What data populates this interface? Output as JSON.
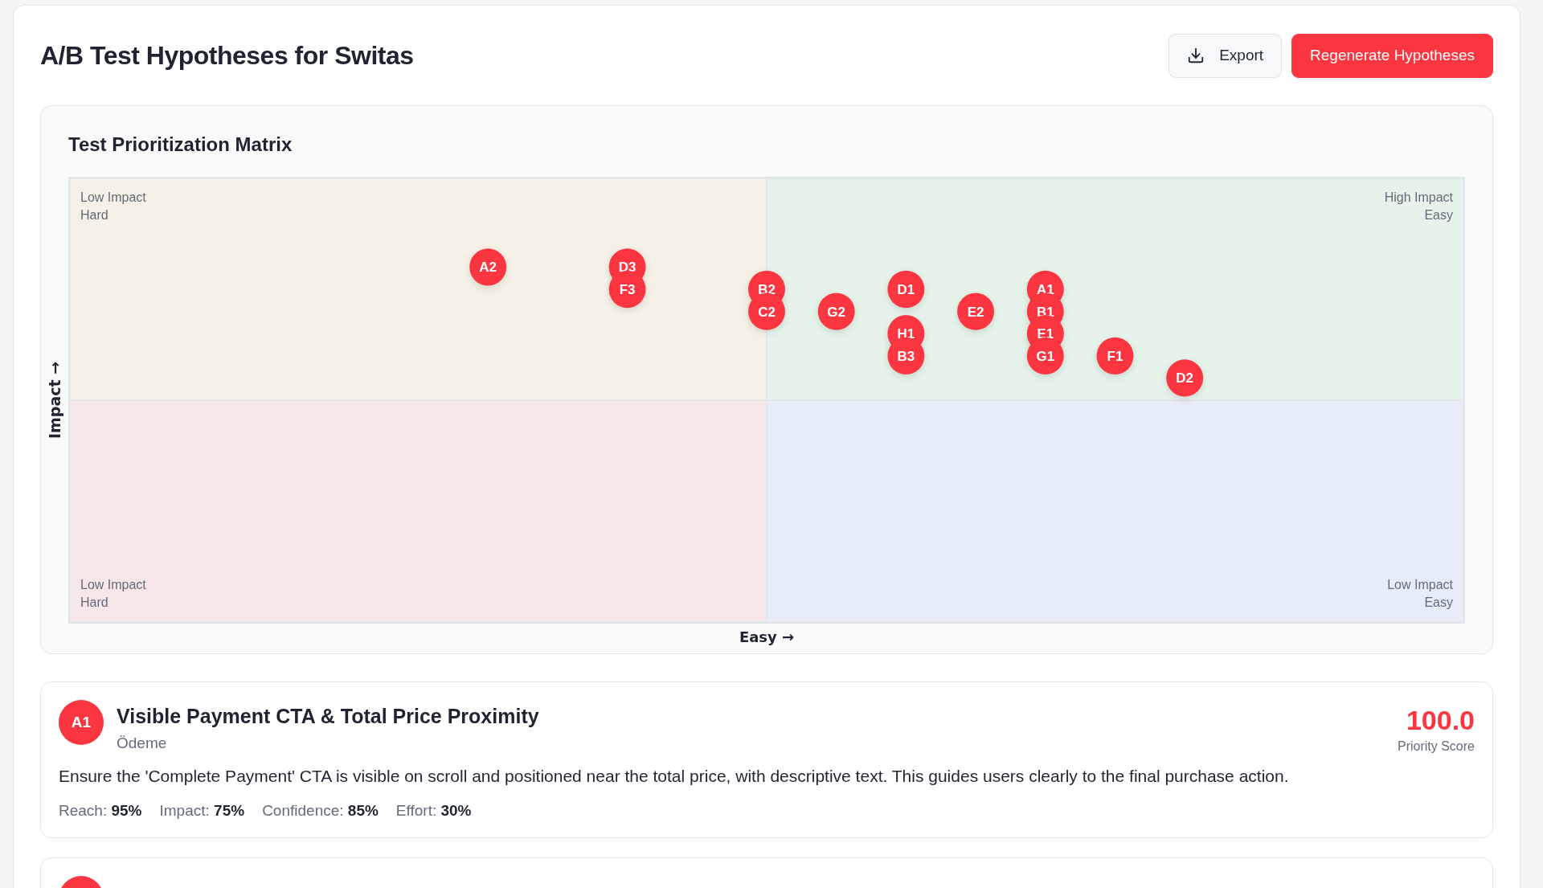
{
  "header": {
    "title": "A/B Test Hypotheses for Switas",
    "buttons": [
      {
        "label": "Export",
        "kind": "secondary"
      },
      {
        "label": "Regenerate Hypotheses",
        "kind": "primary"
      }
    ]
  },
  "matrix": {
    "title": "Test Prioritization Matrix",
    "quadrants": [
      {
        "text": "Low Impact\nHard",
        "color": "#f6f1e6"
      },
      {
        "text": "High Impact\nEasy",
        "color": "#e6f3ea"
      },
      {
        "text": "Low Impact\nHard",
        "color": "#f7e7e8"
      },
      {
        "text": "Low Impact\nEasy",
        "color": "#e6edf9"
      }
    ],
    "y_axis_label": "Impact →",
    "x_axis_label": "Easy →",
    "points": [
      {
        "label": "A2"
      },
      {
        "label": "D3"
      },
      {
        "label": "F3"
      },
      {
        "label": "B2"
      },
      {
        "label": "C2"
      },
      {
        "label": "G2"
      },
      {
        "label": "D1"
      },
      {
        "label": "H1"
      },
      {
        "label": "B3"
      },
      {
        "label": "E2"
      },
      {
        "label": "A1"
      },
      {
        "label": "B1"
      },
      {
        "label": "E1"
      },
      {
        "label": "G1"
      },
      {
        "label": "F1"
      },
      {
        "label": "D2"
      }
    ]
  },
  "hypotheses": [
    {
      "kind": "full",
      "badge": "A1",
      "title": "Visible Payment CTA & Total Price Proximity",
      "category": "Ödeme",
      "score": "100.0",
      "score_label": "Priority Score",
      "description": "Ensure the 'Complete Payment' CTA is visible on scroll and positioned near the total price, with descriptive text. This guides users clearly to the final purchase action.",
      "metrics": [
        {
          "label": "Reach:",
          "value": "95%"
        },
        {
          "label": "Impact:",
          "value": "75%"
        },
        {
          "label": "Confidence:",
          "value": "85%"
        },
        {
          "label": "Effort:",
          "value": "30%"
        }
      ]
    },
    {
      "kind": "cut"
    }
  ]
}
